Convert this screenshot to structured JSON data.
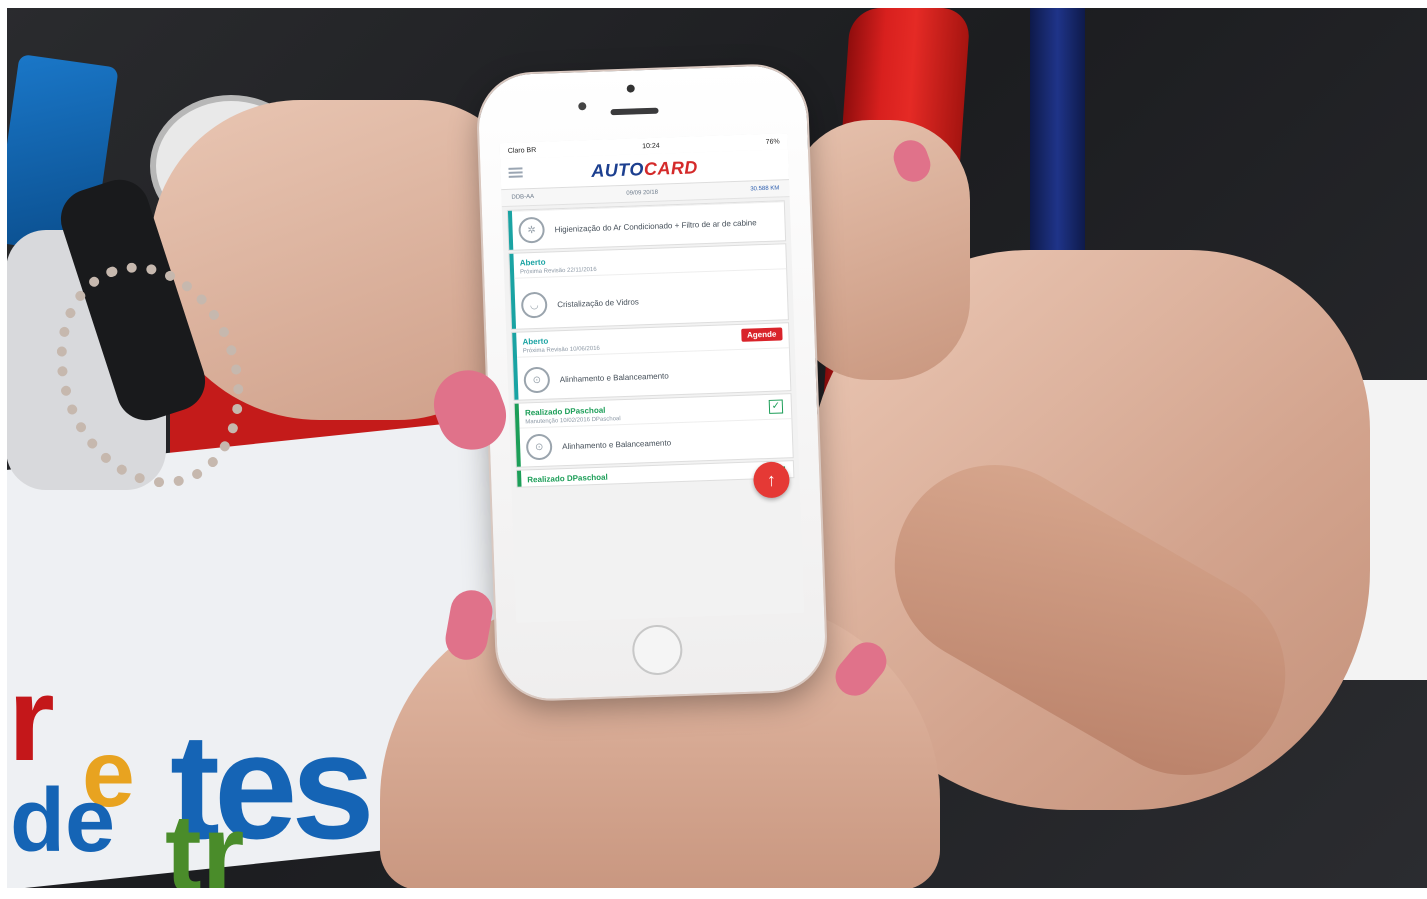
{
  "phone": {
    "statusbar": {
      "carrier": "Claro BR",
      "time": "10:24",
      "battery": "76%"
    },
    "app": {
      "logo_part1": "AUTO",
      "logo_part2": "CARD"
    },
    "infobar": {
      "plate": "DDB-AA",
      "date": "09/09 20/18",
      "km": "30.588 KM"
    },
    "cards": [
      {
        "status": "",
        "meta": "",
        "service": "Higienização do Ar Condicionado + Filtro de ar de cabine",
        "icon": "fan-icon",
        "has_agende": false,
        "has_check": false
      },
      {
        "status": "Aberto",
        "meta": "Próxima Revisão  22/11/2016",
        "service": "Cristalização de Vidros",
        "icon": "glass-icon",
        "has_agende": false,
        "has_check": false
      },
      {
        "status": "Aberto",
        "meta": "Próxima Revisão  10/06/2016",
        "service": "Alinhamento e Balanceamento",
        "icon": "steering-icon",
        "has_agende": true,
        "has_check": false
      },
      {
        "status": "Realizado DPaschoal",
        "meta": "Manutenção  10/02/2016  DPaschoal",
        "service": "Alinhamento e Balanceamento",
        "icon": "steering-icon",
        "has_agende": false,
        "has_check": true
      },
      {
        "status": "Realizado DPaschoal",
        "meta": "",
        "service": "",
        "icon": "",
        "has_agende": false,
        "has_check": true
      }
    ],
    "agende_label": "Agende",
    "fab_label": "↑"
  },
  "banner": {
    "letters_line1": "r",
    "letters_e": "e",
    "letters_tes": "tes",
    "letters_de": "de",
    "letters_tr": "tr"
  },
  "colors": {
    "logo_blue": "#1c3f8f",
    "logo_red": "#d42a2a",
    "status_teal": "#1aa3a3",
    "status_green": "#1c9e58",
    "agende_red": "#d9232a",
    "fab_red": "#e53935"
  }
}
